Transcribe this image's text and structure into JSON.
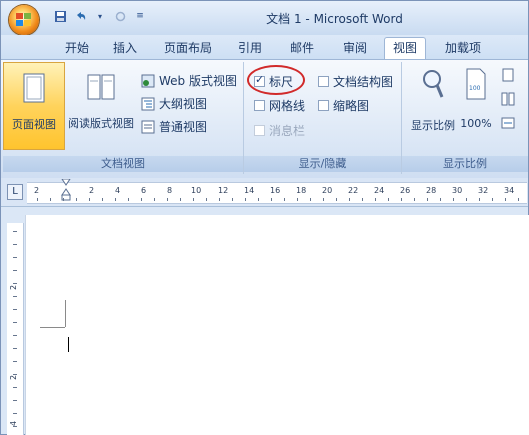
{
  "window": {
    "title": "文档 1 - Microsoft Word"
  },
  "qat": {
    "save_icon": "save-icon",
    "undo_icon": "undo-icon",
    "redo_icon": "redo-icon",
    "customize_icon": "customize-qat-icon"
  },
  "tabs": [
    {
      "label": "开始"
    },
    {
      "label": "插入"
    },
    {
      "label": "页面布局"
    },
    {
      "label": "引用"
    },
    {
      "label": "邮件"
    },
    {
      "label": "审阅"
    },
    {
      "label": "视图"
    },
    {
      "label": "加载项"
    }
  ],
  "ribbon": {
    "doc_views": {
      "group_label": "文档视图",
      "page_view": "页面视图",
      "reading_view": "阅读版式视图",
      "web_view": "Web 版式视图",
      "outline_view": "大纲视图",
      "draft_view": "普通视图"
    },
    "show_hide": {
      "group_label": "显示/隐藏",
      "ruler": "标尺",
      "ruler_checked": true,
      "doc_map": "文档结构图",
      "gridlines": "网格线",
      "thumbnails": "缩略图",
      "message_bar": "消息栏"
    },
    "zoom": {
      "group_label": "显示比例",
      "zoom": "显示比例",
      "zoom_100": "100%"
    }
  },
  "ruler": {
    "numbers": [
      "2",
      "2",
      "4",
      "6",
      "8",
      "10",
      "12",
      "14",
      "16",
      "18",
      "20",
      "22",
      "24",
      "26",
      "28",
      "30",
      "32",
      "34"
    ],
    "v_numbers": [
      "2",
      "2",
      "4"
    ]
  }
}
